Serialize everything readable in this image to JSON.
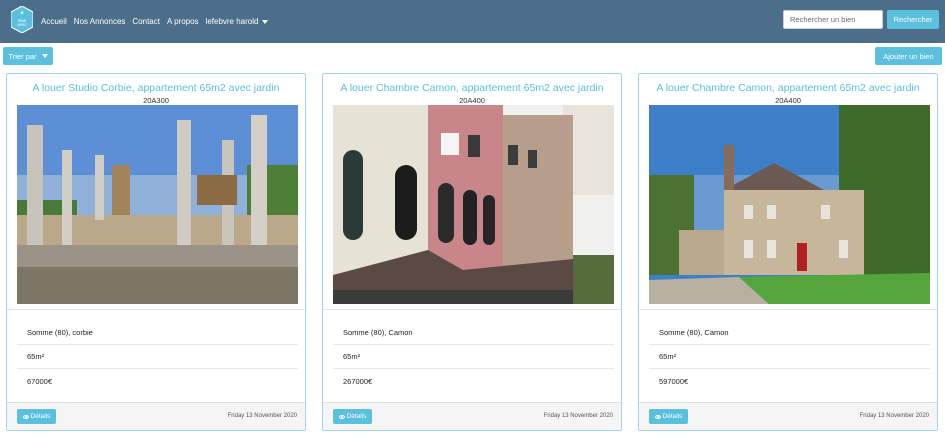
{
  "navbar": {
    "links": [
      "Accueil",
      "Nos Annonces",
      "Contact",
      "A propos"
    ],
    "user_menu": "lefebvre harold",
    "search_placeholder": "Rechercher un bien",
    "search_button": "Rechercher",
    "logo_text": "BRAB IMMO"
  },
  "toolbar": {
    "sort_label": "Trier par",
    "add_label": "Ajouter un bien"
  },
  "cards": [
    {
      "title": "A louer Studio Corbie, appartement 65m2 avec jardin",
      "ref": "20A300",
      "location": "Somme (80), corbie",
      "area": "65m²",
      "price": "67000€",
      "details_label": "Détails",
      "date": "Friday 13 November 2020",
      "photo": "construction-site"
    },
    {
      "title": "A louer Chambre Camon, appartement 65m2 avec jardin",
      "ref": "20A400",
      "location": "Somme (80), Camon",
      "area": "65m²",
      "price": "267000€",
      "details_label": "Détails",
      "date": "Friday 13 November 2020",
      "photo": "brownstone-row-houses"
    },
    {
      "title": "A louer Chambre Camon, appartement 65m2 avec jardin",
      "ref": "20A400",
      "location": "Somme (80), Camon",
      "area": "65m²",
      "price": "597000€",
      "details_label": "Détails",
      "date": "Friday 13 November 2020",
      "photo": "brick-house-with-lawn"
    }
  ],
  "colors": {
    "navbar": "#4b6e8a",
    "accent": "#5bc0de",
    "card_border": "#9fd3ea"
  }
}
